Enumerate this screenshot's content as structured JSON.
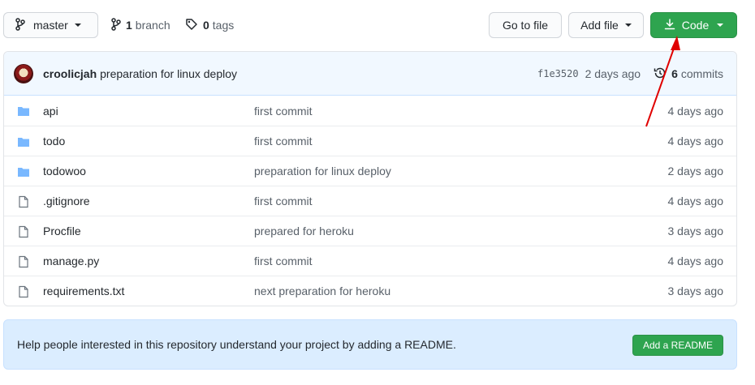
{
  "toolbar": {
    "branch_label": "master",
    "branch_count": "1",
    "branch_word": "branch",
    "tag_count": "0",
    "tag_word": "tags",
    "goto_file": "Go to file",
    "add_file": "Add file",
    "code": "Code"
  },
  "commit": {
    "author": "croolicjah",
    "message": "preparation for linux deploy",
    "sha": "f1e3520",
    "time": "2 days ago",
    "commit_count": "6",
    "commit_word": "commits"
  },
  "files": [
    {
      "name": "api",
      "type": "folder",
      "message": "first commit",
      "age": "4 days ago"
    },
    {
      "name": "todo",
      "type": "folder",
      "message": "first commit",
      "age": "4 days ago"
    },
    {
      "name": "todowoo",
      "type": "folder",
      "message": "preparation for linux deploy",
      "age": "2 days ago"
    },
    {
      "name": ".gitignore",
      "type": "file",
      "message": "first commit",
      "age": "4 days ago"
    },
    {
      "name": "Procfile",
      "type": "file",
      "message": "prepared for heroku",
      "age": "3 days ago"
    },
    {
      "name": "manage.py",
      "type": "file",
      "message": "first commit",
      "age": "4 days ago"
    },
    {
      "name": "requirements.txt",
      "type": "file",
      "message": "next preparation for heroku",
      "age": "3 days ago"
    }
  ],
  "readme": {
    "text": "Help people interested in this repository understand your project by adding a README.",
    "button": "Add a README"
  },
  "colors": {
    "accent_green": "#2ea44f",
    "folder_blue": "#79b8ff",
    "annotation_red": "#e00000"
  }
}
